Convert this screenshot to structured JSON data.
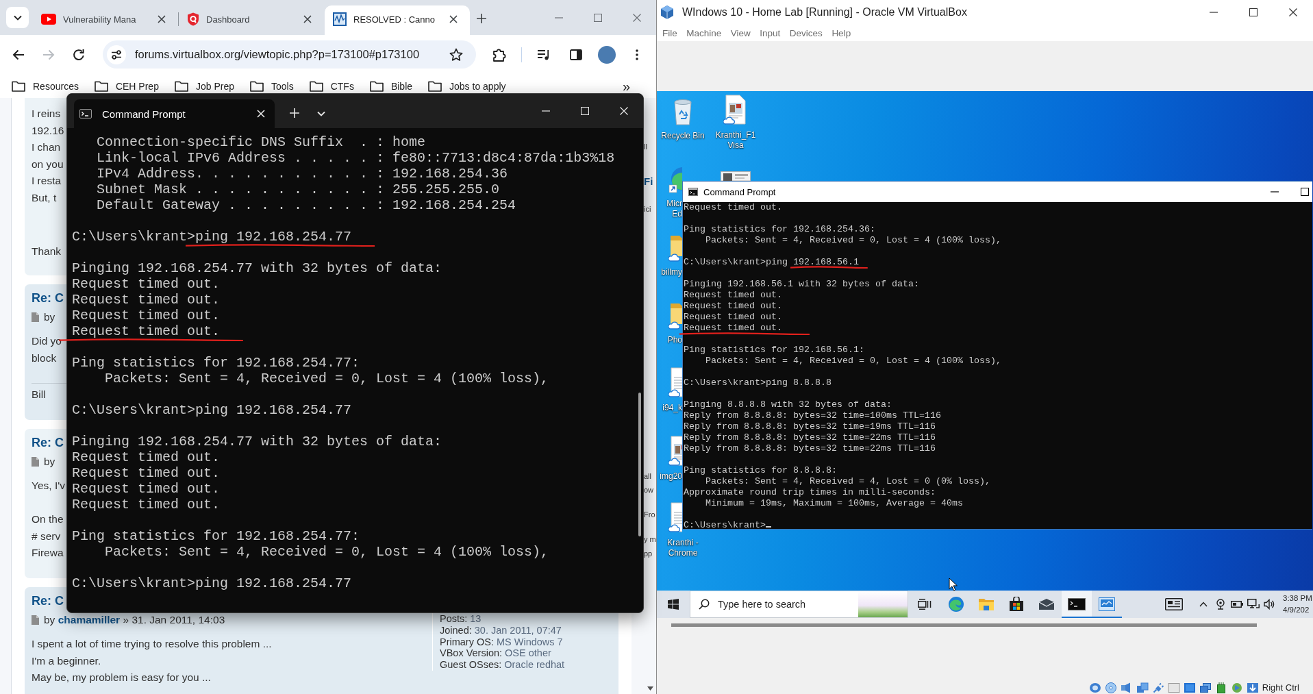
{
  "browser": {
    "tabs": [
      {
        "title": "Vulnerability Mana",
        "kind": "video",
        "selected": false
      },
      {
        "title": "Dashboard",
        "kind": "shield",
        "selected": false
      },
      {
        "title": "RESOLVED : Canno",
        "kind": "wave",
        "selected": true
      }
    ],
    "nav_buttons": [
      {
        "kind": "back",
        "disabled": false
      },
      {
        "kind": "forward",
        "disabled": true
      },
      {
        "kind": "reload",
        "disabled": false
      }
    ],
    "url": "forums.virtualbox.org/viewtopic.php?p=173100#p173100",
    "bookmarks": [
      "Resources",
      "CEH Prep",
      "Job Prep",
      "Tools",
      "CTFs",
      "Bible",
      "Jobs to apply"
    ],
    "bookmarks_overflow": "»",
    "forum": {
      "posts": [
        {
          "paragraphs": [
            [
              "I reins",
              "192.16",
              "I chan",
              "on you",
              "I resta",
              "But, t"
            ],
            [
              "Thank"
            ]
          ]
        },
        {
          "heading": "Re: C",
          "byline": {
            "prefix": "by"
          },
          "paragraphs": [
            [
              "Did yo",
              "block"
            ]
          ],
          "signature": "Bill"
        },
        {
          "heading": "Re: C",
          "byline": {
            "prefix": "by"
          },
          "paragraphs": [
            [
              "Yes, I'v"
            ],
            [
              "On the",
              "# serv",
              "Firewa"
            ]
          ]
        },
        {
          "heading": "Re: C",
          "byline": {
            "prefix": "by",
            "author": "chamamiller",
            "date": "» 31. Jan 2011, 14:03"
          },
          "paragraphs": [
            [
              "I spent a lot of time trying to resolve this problem ...",
              "I'm a beginner.",
              "May be, my problem is easy for you ..."
            ]
          ],
          "profile": [
            {
              "label": "Posts:",
              "value": "13"
            },
            {
              "label": "Joined:",
              "value": "30. Jan 2011, 07:47"
            },
            {
              "label": "Primary OS:",
              "value": "MS Windows 7"
            },
            {
              "label": "VBox Version:",
              "value": "OSE other"
            },
            {
              "label": "Guest OSses:",
              "value": "Oracle redhat"
            }
          ]
        }
      ],
      "side_fragments": [
        {
          "text": "ll",
          "kind": "text"
        },
        {
          "text": "Fi",
          "kind": "heading"
        },
        {
          "text": "ici",
          "kind": "text"
        },
        {
          "text": "all",
          "kind": "text"
        },
        {
          "text": "ow",
          "kind": "text"
        },
        {
          "text": "Fro",
          "kind": "text"
        },
        {
          "text": "y m",
          "kind": "text"
        },
        {
          "text": "pp",
          "kind": "text"
        }
      ]
    },
    "terminal": {
      "kind": "tabbed",
      "title": "Command Prompt",
      "blocks": [
        {
          "kind": "output",
          "lines": [
            {
              "text": "   Connection-specific DNS Suffix  . : home",
              "underlined": false
            },
            {
              "text": "   Link-local IPv6 Address . . . . . : fe80::7713:d8c4:87da:1b3%18",
              "underlined": false
            },
            {
              "text": "   IPv4 Address. . . . . . . . . . . : 192.168.254.36",
              "underlined": false
            },
            {
              "text": "   Subnet Mask . . . . . . . . . . . : 255.255.255.0",
              "underlined": false
            },
            {
              "text": "   Default Gateway . . . . . . . . . : 192.168.254.254",
              "underlined": false
            }
          ]
        },
        {
          "kind": "prompt",
          "prompt": "C:\\Users\\krant>",
          "command": "ping 192.168.254.77",
          "underlined": true,
          "cursor": false
        },
        {
          "kind": "output",
          "lines": [
            {
              "text": "Pinging 192.168.254.77 with 32 bytes of data:",
              "underlined": false
            },
            {
              "text": "Request timed out.",
              "underlined": false
            },
            {
              "text": "Request timed out.",
              "underlined": false
            },
            {
              "text": "Request timed out.",
              "underlined": false
            },
            {
              "text": "Request timed out.",
              "underlined": true
            }
          ]
        },
        {
          "kind": "output",
          "lines": [
            {
              "text": "Ping statistics for 192.168.254.77:",
              "underlined": false
            },
            {
              "text": "    Packets: Sent = 4, Received = 0, Lost = 4 (100% loss),",
              "underlined": false
            }
          ]
        },
        {
          "kind": "prompt",
          "prompt": "C:\\Users\\krant>",
          "command": "ping 192.168.254.77",
          "underlined": false,
          "cursor": false
        },
        {
          "kind": "output",
          "lines": [
            {
              "text": "Pinging 192.168.254.77 with 32 bytes of data:",
              "underlined": false
            },
            {
              "text": "Request timed out.",
              "underlined": false
            },
            {
              "text": "Request timed out.",
              "underlined": false
            },
            {
              "text": "Request timed out.",
              "underlined": false
            },
            {
              "text": "Request timed out.",
              "underlined": false
            }
          ]
        },
        {
          "kind": "output",
          "lines": [
            {
              "text": "Ping statistics for 192.168.254.77:",
              "underlined": false
            },
            {
              "text": "    Packets: Sent = 4, Received = 0, Lost = 4 (100% loss),",
              "underlined": false
            }
          ]
        },
        {
          "kind": "prompt",
          "prompt": "C:\\Users\\krant>",
          "command": "ping 192.168.254.77",
          "underlined": false,
          "cursor": false
        }
      ]
    }
  },
  "virtualbox": {
    "title": "WIndows 10 - Home Lab [Running] - Oracle VM VirtualBox",
    "menu": [
      "File",
      "Machine",
      "View",
      "Input",
      "Devices",
      "Help"
    ],
    "desktop_icons": [
      {
        "kind": "recycle-bin",
        "label": [
          "Recycle Bin"
        ],
        "cloud": false
      },
      {
        "kind": "image-file",
        "label": [
          "Kranthi_F1",
          "Visa"
        ],
        "cloud": true
      },
      {
        "kind": "browser",
        "label": [
          "Micr",
          "Ed"
        ],
        "cloud": false
      },
      {
        "kind": "photo"
      },
      {
        "kind": "folder",
        "label": [
          "billmy"
        ],
        "cloud": true
      },
      {
        "kind": "folder",
        "label": [
          "Pho"
        ],
        "cloud": true
      },
      {
        "kind": "document",
        "label": [
          "i94_k"
        ],
        "cloud": true
      },
      {
        "kind": "image-file",
        "label": [
          "img20"
        ],
        "cloud": true
      },
      {
        "kind": "document",
        "label": [
          "Kranthi -",
          "Chrome"
        ],
        "cloud": true
      }
    ],
    "terminal": {
      "kind": "classic",
      "title": "Command Prompt",
      "blocks": [
        {
          "kind": "output",
          "lines": [
            {
              "text": "Request timed out.",
              "underlined": false
            }
          ]
        },
        {
          "kind": "output",
          "lines": [
            {
              "text": "Ping statistics for 192.168.254.36:",
              "underlined": false
            },
            {
              "text": "    Packets: Sent = 4, Received = 0, Lost = 4 (100% loss),",
              "underlined": false
            }
          ]
        },
        {
          "kind": "prompt",
          "prompt": "C:\\Users\\krant>",
          "command": "ping 192.168.56.1",
          "underlined": true,
          "cursor": false
        },
        {
          "kind": "output",
          "lines": [
            {
              "text": "Pinging 192.168.56.1 with 32 bytes of data:",
              "underlined": false
            },
            {
              "text": "Request timed out.",
              "underlined": false
            },
            {
              "text": "Request timed out.",
              "underlined": false
            },
            {
              "text": "Request timed out.",
              "underlined": false
            },
            {
              "text": "Request timed out.",
              "underlined": true
            }
          ]
        },
        {
          "kind": "output",
          "lines": [
            {
              "text": "Ping statistics for 192.168.56.1:",
              "underlined": false
            },
            {
              "text": "    Packets: Sent = 4, Received = 0, Lost = 4 (100% loss),",
              "underlined": false
            }
          ]
        },
        {
          "kind": "prompt",
          "prompt": "C:\\Users\\krant>",
          "command": "ping 8.8.8.8",
          "underlined": false,
          "cursor": false
        },
        {
          "kind": "output",
          "lines": [
            {
              "text": "Pinging 8.8.8.8 with 32 bytes of data:",
              "underlined": false
            },
            {
              "text": "Reply from 8.8.8.8: bytes=32 time=100ms TTL=116",
              "underlined": false
            },
            {
              "text": "Reply from 8.8.8.8: bytes=32 time=19ms TTL=116",
              "underlined": false
            },
            {
              "text": "Reply from 8.8.8.8: bytes=32 time=22ms TTL=116",
              "underlined": false
            },
            {
              "text": "Reply from 8.8.8.8: bytes=32 time=22ms TTL=116",
              "underlined": false
            }
          ]
        },
        {
          "kind": "output",
          "lines": [
            {
              "text": "Ping statistics for 8.8.8.8:",
              "underlined": false
            },
            {
              "text": "    Packets: Sent = 4, Received = 4, Lost = 0 (0% loss),",
              "underlined": false
            },
            {
              "text": "Approximate round trip times in milli-seconds:",
              "underlined": false
            },
            {
              "text": "    Minimum = 19ms, Maximum = 100ms, Average = 40ms",
              "underlined": false
            }
          ]
        },
        {
          "kind": "prompt",
          "prompt": "C:\\Users\\krant>",
          "underlined": false,
          "cursor": true
        }
      ]
    },
    "taskbar": {
      "search": {
        "placeholder": "Type here to search"
      },
      "apps": [
        {
          "kind": "task-view",
          "running": false,
          "focused": false
        },
        {
          "kind": "edge",
          "running": false,
          "focused": false
        },
        {
          "kind": "explorer",
          "running": false,
          "focused": false
        },
        {
          "kind": "store",
          "running": false,
          "focused": false
        },
        {
          "kind": "mail",
          "running": false,
          "focused": false
        },
        {
          "kind": "terminal",
          "running": true,
          "focused": true
        },
        {
          "kind": "control-panel",
          "running": true,
          "focused": false
        }
      ],
      "time": "3:38 PM",
      "date": "4/9/202"
    },
    "host_key": "Right Ctrl"
  }
}
